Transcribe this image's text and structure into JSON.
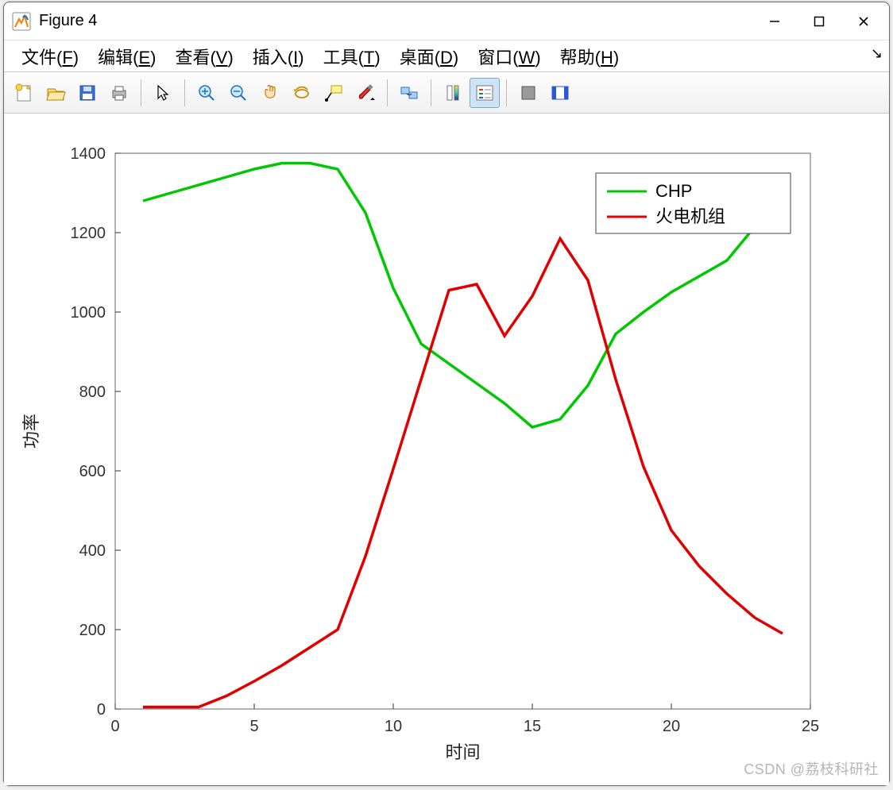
{
  "window": {
    "title": "Figure 4",
    "minimize": "–",
    "maximize": "☐",
    "close": "✕"
  },
  "menu": {
    "file": "文件(F)",
    "edit": "编辑(E)",
    "view": "查看(V)",
    "insert": "插入(I)",
    "tools": "工具(T)",
    "desktop": "桌面(D)",
    "window": "窗口(W)",
    "help": "帮助(H)"
  },
  "toolbar_icons": {
    "new": "new-icon",
    "open": "open-icon",
    "save": "save-icon",
    "print": "print-icon",
    "pointer": "pointer-icon",
    "zoomin": "zoom-in-icon",
    "zoomout": "zoom-out-icon",
    "pan": "pan-icon",
    "rotate": "rotate-icon",
    "datatip": "datatip-icon",
    "brush": "brush-icon",
    "link": "link-icon",
    "colorbar": "colorbar-icon",
    "legend": "legend-icon",
    "hide": "hide-icon",
    "ploteditor": "plot-editor-icon"
  },
  "watermark": "CSDN @荔枝科研社",
  "chart_data": {
    "type": "line",
    "xlabel": "时间",
    "ylabel": "功率",
    "xlim": [
      0,
      25
    ],
    "ylim": [
      0,
      1400
    ],
    "xticks": [
      0,
      5,
      10,
      15,
      20,
      25
    ],
    "yticks": [
      0,
      200,
      400,
      600,
      800,
      1000,
      1200,
      1400
    ],
    "x": [
      1,
      2,
      3,
      4,
      5,
      6,
      7,
      8,
      9,
      10,
      11,
      12,
      13,
      14,
      15,
      16,
      17,
      18,
      19,
      20,
      21,
      22,
      23,
      24
    ],
    "series": [
      {
        "name": "CHP",
        "color": "#00c800",
        "values": [
          1280,
          1300,
          1320,
          1340,
          1360,
          1375,
          1375,
          1360,
          1250,
          1060,
          920,
          870,
          820,
          770,
          710,
          730,
          815,
          945,
          1000,
          1050,
          1090,
          1130,
          1215,
          1305
        ]
      },
      {
        "name": "火电机组",
        "color": "#e10000",
        "values": [
          5,
          5,
          5,
          33,
          70,
          110,
          155,
          200,
          385,
          605,
          830,
          1055,
          1070,
          940,
          1040,
          1185,
          1080,
          830,
          610,
          450,
          360,
          290,
          230,
          190
        ]
      }
    ],
    "legend": {
      "entries": [
        "CHP",
        "火电机组"
      ],
      "position": "northeast"
    }
  }
}
